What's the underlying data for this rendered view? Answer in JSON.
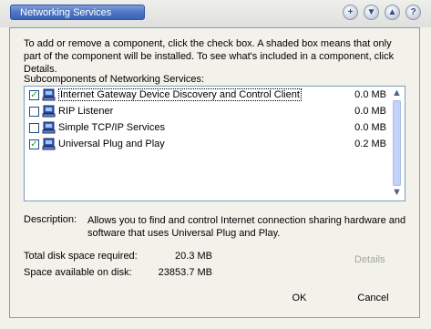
{
  "window": {
    "title": "Networking Services",
    "controls": [
      {
        "name": "minimize-icon",
        "glyph": "+"
      },
      {
        "name": "arrow-down-icon",
        "glyph": "▼"
      },
      {
        "name": "arrow-up-icon",
        "glyph": "▲"
      },
      {
        "name": "help-icon",
        "glyph": "?"
      }
    ]
  },
  "intro": "To add or remove a component, click the check box. A shaded box means that only part of the component will be installed. To see what's included in a component, click Details.",
  "subcomponents_label": "Subcomponents of Networking Services:",
  "components": [
    {
      "name": "Internet Gateway Device Discovery and Control Client",
      "size": "0.0 MB",
      "checked": true,
      "selected": true
    },
    {
      "name": "RIP Listener",
      "size": "0.0 MB",
      "checked": false,
      "selected": false
    },
    {
      "name": "Simple TCP/IP Services",
      "size": "0.0 MB",
      "checked": false,
      "selected": false
    },
    {
      "name": "Universal Plug and Play",
      "size": "0.2 MB",
      "checked": true,
      "selected": false
    }
  ],
  "description": {
    "label": "Description:",
    "text": "Allows you to find and control Internet connection sharing hardware and software that uses Universal Plug and Play."
  },
  "disk": {
    "required_label": "Total disk space required:",
    "required_value": "20.3 MB",
    "available_label": "Space available on disk:",
    "available_value": "23853.7 MB"
  },
  "buttons": {
    "details": "Details",
    "ok": "OK",
    "cancel": "Cancel"
  },
  "colors": {
    "title_pill": "#4f76c4",
    "dialog_bg": "#f2f1ea",
    "checkmark": "#21a121",
    "disabled_text": "#a3a79a"
  }
}
